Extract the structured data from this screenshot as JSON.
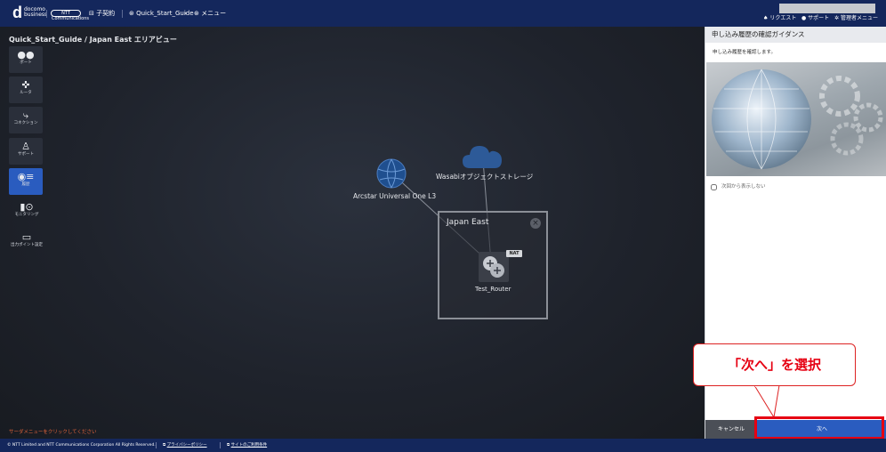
{
  "header": {
    "logo_mark": "d",
    "logo_line1": "docomo",
    "logo_line2": "business",
    "ntt_logo_text": "NTT Communications",
    "contract": "子契約",
    "breadcrumb": [
      "Quick_Start_Guide",
      "メニュー"
    ],
    "links": [
      "リクエスト",
      "サポート",
      "管理者メニュー"
    ]
  },
  "canvas": {
    "title": "Quick_Start_Guide / Japan East エリアビュー",
    "sidebar": [
      {
        "label": "ポート",
        "icon": "port-icon"
      },
      {
        "label": "ルータ",
        "icon": "router-icon"
      },
      {
        "label": "コネクション",
        "icon": "connection-icon"
      },
      {
        "label": "サポート",
        "icon": "support-icon"
      },
      {
        "label": "履歴",
        "icon": "history-icon",
        "active": true
      },
      {
        "label": "モニタリング",
        "icon": "monitoring-icon"
      },
      {
        "label": "出力ポイント設定",
        "icon": "monitor-icon"
      }
    ],
    "hint": "サーダメニューをクリックしてください",
    "nodes": {
      "arcstar": "Arcstar Universal One L3",
      "wasabi": "Wasabiオブジェクトストレージ"
    },
    "region": {
      "name": "Japan East",
      "router_label": "Test_Router",
      "badge": "NAT"
    }
  },
  "guide": {
    "title": "申し込み履歴の確認ガイダンス",
    "description": "申し込み履歴を確認します。",
    "checkbox_label": "次回から表示しない",
    "cancel_label": "キャンセル",
    "next_label": "次へ"
  },
  "callout": {
    "text": "「次へ」を選択"
  },
  "footer": {
    "copyright": "© NTT Limited and NTT Communications Corporation All Rights Reserved.",
    "privacy": "プライバシーポリシー",
    "terms": "サイトのご利用条件"
  },
  "colors": {
    "header_bg": "#14275c",
    "accent": "#2a5cbf",
    "highlight": "#e60012"
  }
}
